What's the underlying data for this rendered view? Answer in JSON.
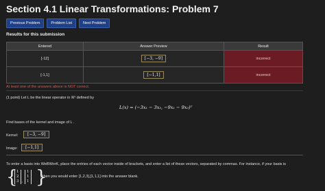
{
  "title": "Section 4.1 Linear Transformations: Problem 7",
  "nav": {
    "previous": "Previous Problem",
    "list": "Problem List",
    "next": "Next Problem"
  },
  "results": {
    "heading": "Results for this submission",
    "headers": {
      "entered": "Entered",
      "preview": "Answer Preview",
      "result": "Result"
    },
    "rows": [
      {
        "entered": "[-12]",
        "preview": "[−3, −9]",
        "result": "incorrect"
      },
      {
        "entered": "[-1,1]",
        "preview": "[−1,1]",
        "result": "incorrect"
      }
    ],
    "warning": "At least one of the answers above is NOT correct."
  },
  "problem": {
    "intro": "(1 point) Let L be the linear operator in ℝ³ defined by",
    "formula": "L(x) = (−3x₁ − 3x₃, −9x₁ − 9x₃)ᵀ",
    "task": "Find bases of the kernel and image of L .",
    "kernel_label": "Kernel:",
    "kernel_value": "[−3, −9]",
    "image_label": "Image:",
    "image_value": "[−1,1]",
    "instructions": "To enter a basis into WeBWorK, place the entries of each vector inside of brackets, and enter a list of these vectors, separated by commas. For instance, if your basis is",
    "example_tail": ", then you would enter [1,2,3],[1,1,1] into the answer blank.",
    "example_vectors": [
      [
        "1",
        "2",
        "3"
      ],
      [
        "1",
        "1",
        "1"
      ]
    ]
  }
}
